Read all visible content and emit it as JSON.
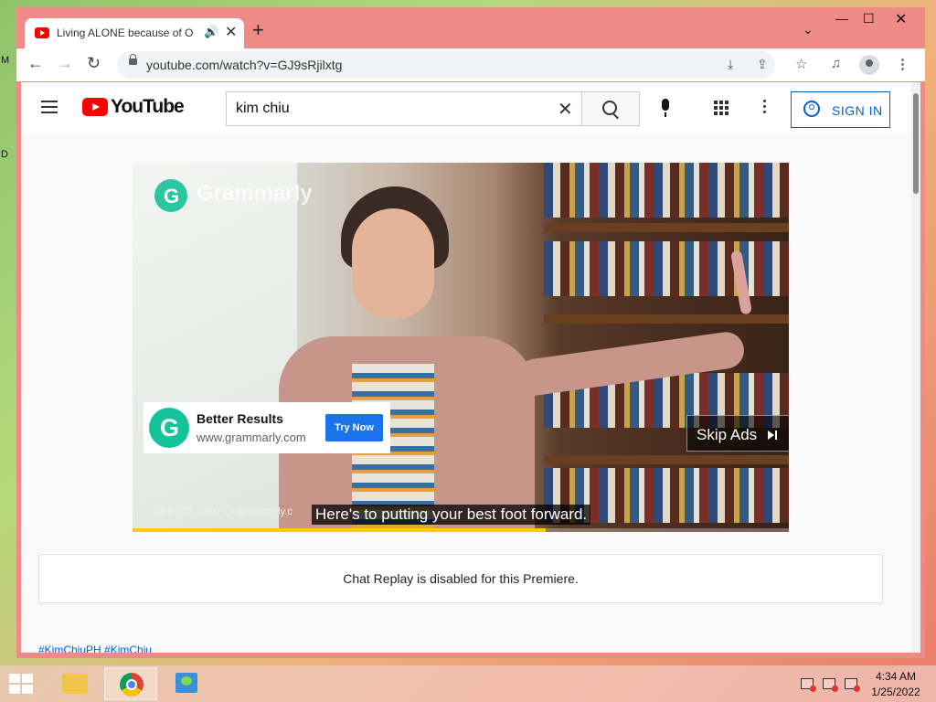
{
  "browser": {
    "tab_title": "Living ALONE because of Omicron",
    "url": "youtube.com/watch?v=GJ9sRjilxtg",
    "new_tab": "+",
    "tab_close": "✕",
    "tab_audio": "🔊"
  },
  "youtube": {
    "logo_text": "YouTube",
    "search_value": "kim chiu",
    "sign_in": "SIGN IN"
  },
  "ad": {
    "brand_watermark": "Grammarly",
    "card_title": "Better Results",
    "card_url": "www.grammarly.com",
    "cta": "Try Now",
    "skip": "Skip Ads",
    "info": "Ad 1 of 2 · 0:07",
    "info_source": "grammarly.c",
    "caption": "Here's to putting your best foot forward.",
    "progress_fraction": 0.63
  },
  "chat": {
    "message": "Chat Replay is disabled for this Premiere."
  },
  "description": {
    "hashtags": "#KimChiuPH #KimChiu"
  },
  "taskbar": {
    "time": "4:34 AM",
    "date": "1/25/2022"
  },
  "colors": {
    "youtube_red": "#ff0000",
    "link_blue": "#065fd4",
    "grammarly_green": "#15c39a",
    "ad_progress": "#ffcc00"
  }
}
